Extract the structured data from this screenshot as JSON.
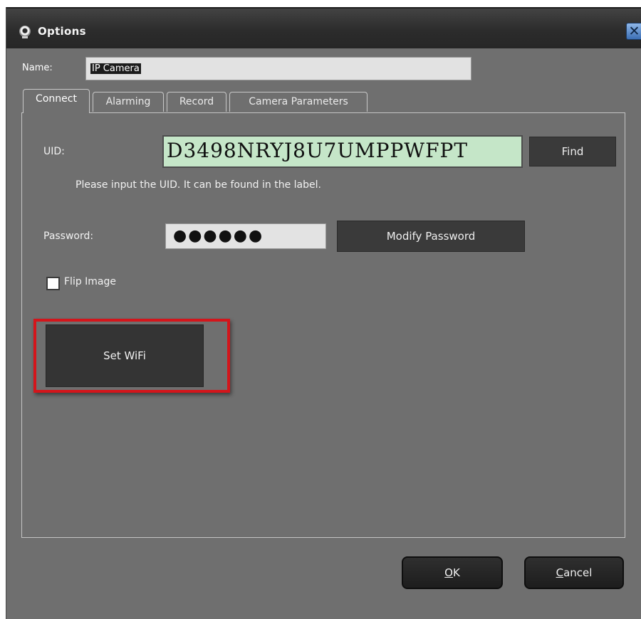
{
  "window": {
    "title": "Options",
    "close_symbol": "✕"
  },
  "name": {
    "label": "Name:",
    "value": "IP Camera"
  },
  "tabs": [
    {
      "label": "Connect",
      "active": true
    },
    {
      "label": "Alarming",
      "active": false
    },
    {
      "label": "Record",
      "active": false
    },
    {
      "label": "Camera Parameters",
      "active": false
    }
  ],
  "connect": {
    "uid_label": "UID:",
    "uid_value": "D3498NRYJ8U7UMPPWFPT",
    "find_label": "Find",
    "hint": "Please input the UID. It can be found in the label.",
    "password_label": "Password:",
    "password_value": "●●●●●●",
    "modify_password_label": "Modify Password",
    "flip_image_label": "Flip Image",
    "flip_image_checked": false,
    "set_wifi_label": "Set WiFi"
  },
  "footer": {
    "ok_mnemonic": "O",
    "ok_rest": "K",
    "cancel_mnemonic": "C",
    "cancel_rest": "ancel"
  },
  "colors": {
    "dialog_bg": "#6f6f6f",
    "uid_field_bg": "#c5e6c8",
    "highlight_border": "#d4151b"
  },
  "icons": {
    "title_icon": "webcam-icon",
    "close_icon": "close-icon"
  }
}
